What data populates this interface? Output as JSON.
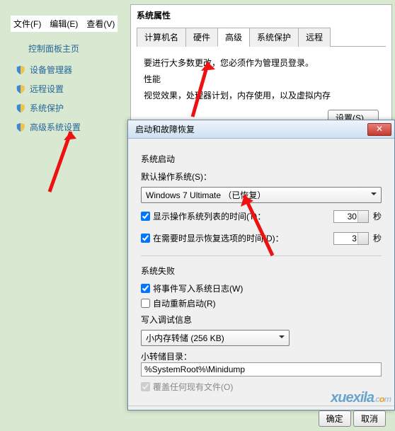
{
  "menubar": {
    "file": "文件(F)",
    "edit": "编辑(E)",
    "view": "查看(V)"
  },
  "panel_title": "控制面板主页",
  "sidebar": [
    {
      "label": "设备管理器"
    },
    {
      "label": "远程设置"
    },
    {
      "label": "系统保护"
    },
    {
      "label": "高级系统设置"
    }
  ],
  "prop": {
    "title": "系统属性",
    "tabs": {
      "t0": "计算机名",
      "t1": "硬件",
      "t2": "高级",
      "t3": "系统保护",
      "t4": "远程"
    },
    "warn": "要进行大多数更改，您必须作为管理员登录。",
    "perf_title": "性能",
    "perf_desc": "视觉效果，处理器计划，内存使用，以及虚拟内存",
    "settings_btn": "设置(S)..."
  },
  "recov": {
    "title": "启动和故障恢复",
    "startup_title": "系统启动",
    "default_os_label": "默认操作系统(S)：",
    "default_os_value": "Windows 7 Ultimate （已恢复）",
    "chk_list": "显示操作系统列表的时间(T)：",
    "chk_recov": "在需要时显示恢复选项的时间(D)：",
    "time_list": "30",
    "time_recov": "3",
    "sec": "秒",
    "fail_title": "系统失败",
    "chk_log": "将事件写入系统日志(W)",
    "chk_auto": "自动重新启动(R)",
    "dump_label": "写入调试信息",
    "dump_select": "小内存转储 (256 KB)",
    "dump_dir_label": "小转储目录：",
    "dump_dir_value": "%SystemRoot%\\Minidump",
    "chk_overwrite": "覆盖任何现有文件(O)",
    "ok": "确定",
    "cancel": "取消"
  },
  "watermark": "xuexila"
}
